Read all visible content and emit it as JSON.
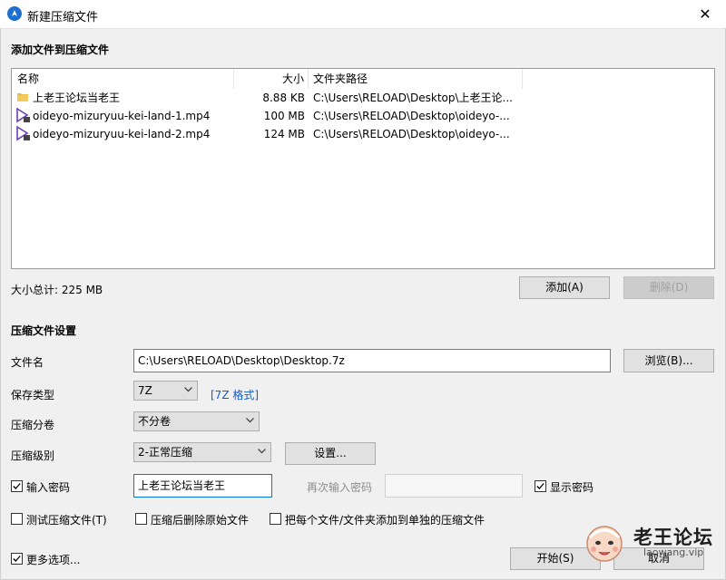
{
  "window": {
    "title": "新建压缩文件",
    "close": "✕"
  },
  "add_section": {
    "title": "添加文件到压缩文件",
    "columns": {
      "name": "名称",
      "size": "大小",
      "path": "文件夹路径"
    },
    "files": [
      {
        "name": "上老王论坛当老王",
        "size": "8.88 KB",
        "path": "C:\\Users\\RELOAD\\Desktop\\上老王论...",
        "icon": "folder-icon"
      },
      {
        "name": "oideyo-mizuryuu-kei-land-1.mp4",
        "size": "100 MB",
        "path": "C:\\Users\\RELOAD\\Desktop\\oideyo-...",
        "icon": "video-file-icon"
      },
      {
        "name": "oideyo-mizuryuu-kei-land-2.mp4",
        "size": "124 MB",
        "path": "C:\\Users\\RELOAD\\Desktop\\oideyo-...",
        "icon": "video-file-icon"
      }
    ],
    "total_label": "大小总计: 225 MB",
    "add_button": "添加(A)",
    "delete_button": "删除(D)"
  },
  "settings": {
    "title": "压缩文件设置",
    "filename_label": "文件名",
    "filename_value": "C:\\Users\\RELOAD\\Desktop\\Desktop.7z",
    "browse_button": "浏览(B)...",
    "type_label": "保存类型",
    "type_value": "7Z",
    "type_link": "[7Z 格式]",
    "volume_label": "压缩分卷",
    "volume_value": "不分卷",
    "level_label": "压缩级别",
    "level_value": "2-正常压缩",
    "settings_button": "设置...",
    "password_label": "输入密码",
    "password_checked": true,
    "password_value": "上老王论坛当老王",
    "password_confirm_label": "再次输入密码",
    "show_password_label": "显示密码",
    "show_password_checked": true,
    "test_label": "测试压缩文件(T)",
    "test_checked": false,
    "delete_after_label": "压缩后删除原始文件",
    "delete_after_checked": false,
    "separate_label": "把每个文件/文件夹添加到单独的压缩文件",
    "separate_checked": false,
    "more_options_label": "更多选项...",
    "more_options_checked": true,
    "start_button": "开始(S)",
    "cancel_button": "取消"
  },
  "watermark": {
    "text": "老王论坛",
    "sub": "laowang.vip"
  }
}
